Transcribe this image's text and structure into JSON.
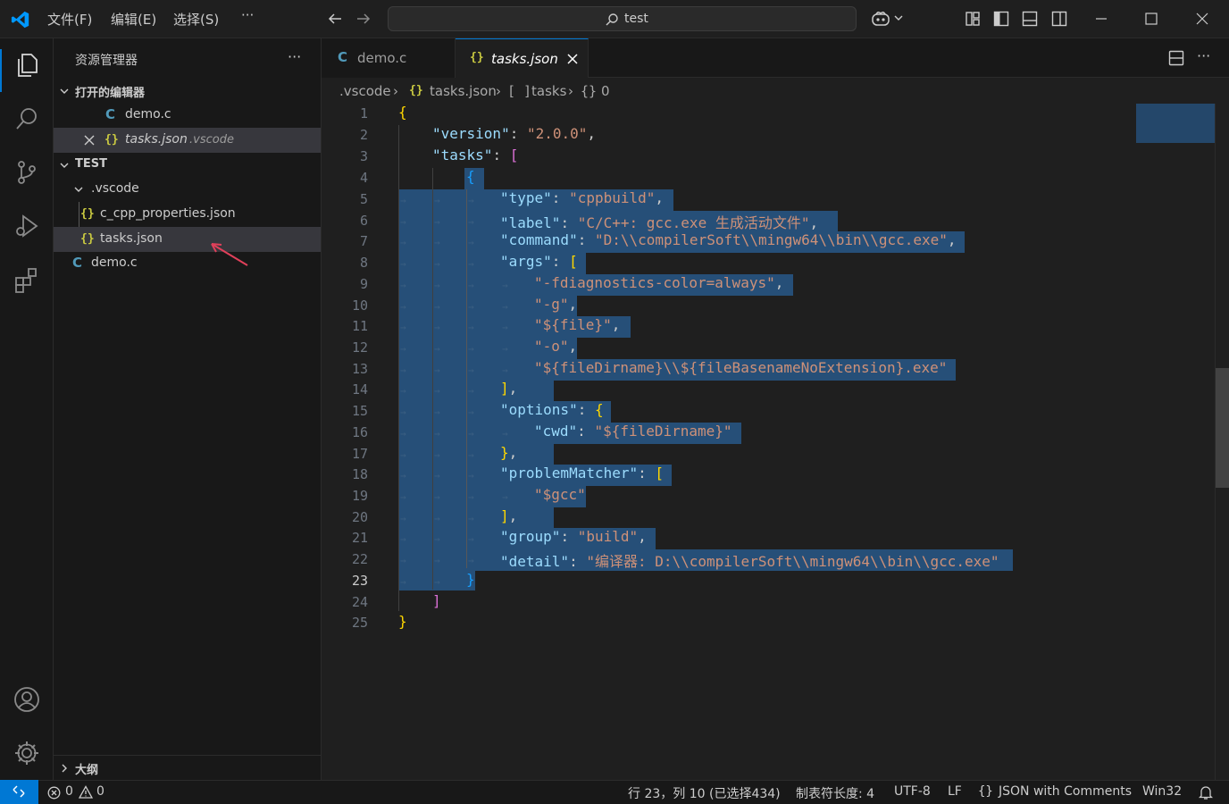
{
  "menu": [
    "文件(F)",
    "编辑(E)",
    "选择(S)",
    "···"
  ],
  "search": {
    "text": "test"
  },
  "sidebar": {
    "title": "资源管理器",
    "more": "···",
    "open_editors_header": "打开的编辑器",
    "open_editors": [
      {
        "label": "demo.c",
        "icon": "c-file-icon"
      },
      {
        "label": "tasks.json",
        "folder": ".vscode",
        "icon": "json-file-icon"
      }
    ],
    "workspace_header": "TEST",
    "folder": ".vscode",
    "files": [
      {
        "label": "c_cpp_properties.json"
      },
      {
        "label": "tasks.json"
      }
    ],
    "root_file": "demo.c",
    "outline_header": "大纲"
  },
  "tabs": [
    {
      "label": "demo.c",
      "active": false
    },
    {
      "label": "tasks.json",
      "active": true
    }
  ],
  "breadcrumb": [
    ".vscode",
    "tasks.json",
    "tasks",
    "0"
  ],
  "code_lines": [
    {
      "n": "1"
    },
    {
      "n": "2"
    },
    {
      "n": "3"
    },
    {
      "n": "4"
    },
    {
      "n": "5"
    },
    {
      "n": "6"
    },
    {
      "n": "7"
    },
    {
      "n": "8"
    },
    {
      "n": "9"
    },
    {
      "n": "10"
    },
    {
      "n": "11"
    },
    {
      "n": "12"
    },
    {
      "n": "13"
    },
    {
      "n": "14"
    },
    {
      "n": "15"
    },
    {
      "n": "16"
    },
    {
      "n": "17"
    },
    {
      "n": "18"
    },
    {
      "n": "19"
    },
    {
      "n": "20"
    },
    {
      "n": "21"
    },
    {
      "n": "22"
    },
    {
      "n": "23"
    },
    {
      "n": "24"
    },
    {
      "n": "25"
    }
  ],
  "code": {
    "version_key": "\"version\"",
    "version_val": "\"2.0.0\"",
    "tasks_key": "\"tasks\"",
    "type_key": "\"type\"",
    "type_val": "\"cppbuild\"",
    "label_key": "\"label\"",
    "label_val": "\"C/C++: gcc.exe 生成活动文件\"",
    "command_key": "\"command\"",
    "command_val": "\"D:\\\\compilerSoft\\\\mingw64\\\\bin\\\\gcc.exe\"",
    "args_key": "\"args\"",
    "arg1": "\"-fdiagnostics-color=always\"",
    "arg2": "\"-g\"",
    "arg3": "\"${file}\"",
    "arg4": "\"-o\"",
    "arg5": "\"${fileDirname}\\\\${fileBasenameNoExtension}.exe\"",
    "options_key": "\"options\"",
    "cwd_key": "\"cwd\"",
    "cwd_val": "\"${fileDirname}\"",
    "pm_key": "\"problemMatcher\"",
    "pm_val": "\"$gcc\"",
    "group_key": "\"group\"",
    "group_val": "\"build\"",
    "detail_key": "\"detail\"",
    "detail_val": "\"编译器: D:\\\\compilerSoft\\\\mingw64\\\\bin\\\\gcc.exe\""
  },
  "status": {
    "errors": "0",
    "warnings": "0",
    "position": "行 23，列 10 (已选择434)",
    "indent": "制表符长度: 4",
    "encoding": "UTF-8",
    "eol": "LF",
    "language": "JSON with Comments",
    "platform": "Win32"
  },
  "colors": {
    "accent": "#0078d4",
    "selection": "#264f78",
    "background": "#1f1f1f"
  }
}
